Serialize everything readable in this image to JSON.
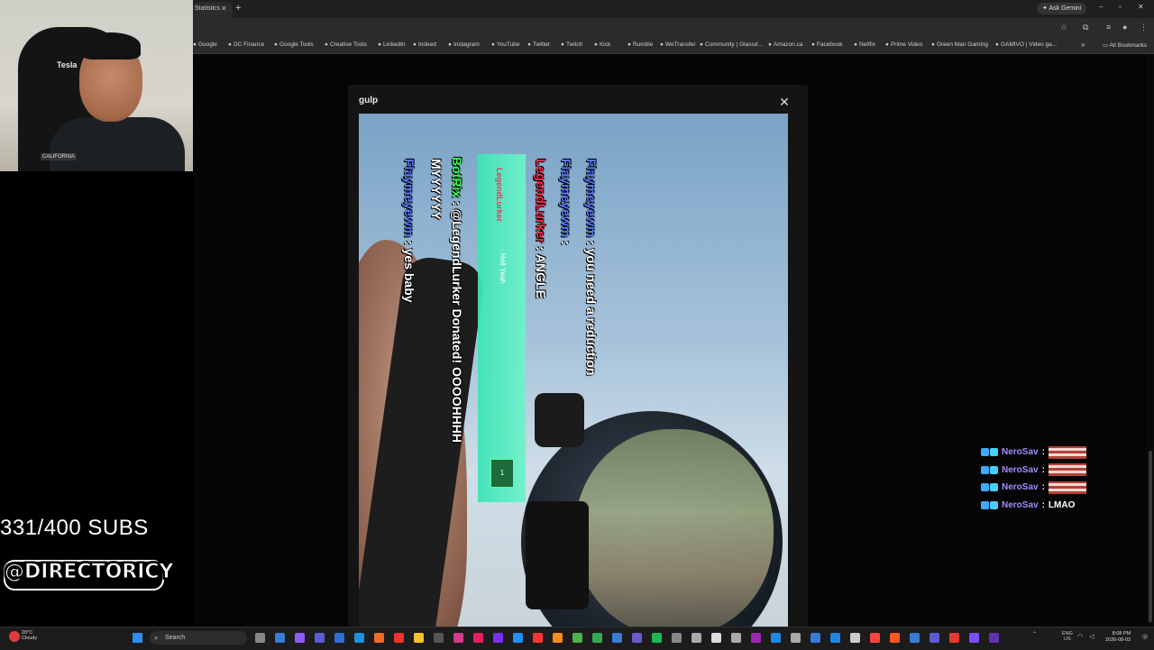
{
  "browser": {
    "tab_title": "Statistics",
    "tab_close": "✕",
    "new_tab": "+",
    "ask_gemini": "Ask Gemini",
    "bookmarks": [
      "Google",
      "DC Finance",
      "Google Tools",
      "Creative Tools",
      "LinkedIn",
      "Indeed",
      "Instagram",
      "YouTube",
      "Twitter",
      "Twitch",
      "Kick",
      "Rumble",
      "WeTransfer",
      "Community | Glassd...",
      "Amazon.ca",
      "Facebook",
      "Netflix",
      "Prime Video",
      "Green Man Gaming",
      "GAMIVO | Video ga..."
    ],
    "all_bookmarks": "All Bookmarks"
  },
  "modal": {
    "title": "gulp",
    "close": "✕"
  },
  "video_chat": [
    {
      "user": "Flaymeyewm",
      "sep": " : ",
      "msg": "you need a reduction",
      "color": "blue"
    },
    {
      "user": "Flaymeyewm",
      "sep": " : ",
      "msg": "",
      "color": "blue"
    },
    {
      "user": "LegendLurker",
      "sep": " : ",
      "msg": "ANGLE",
      "color": "red"
    },
    {
      "user": "BotRix",
      "sep": " : ",
      "msg": "@LegendLurker Donated! OOOOHHHH",
      "color": "green"
    },
    {
      "user": "",
      "sep": "",
      "msg": "MYYYYYY",
      "color": "white"
    },
    {
      "user": "Flaymeyewm",
      "sep": " : ",
      "msg": "yes baby",
      "color": "blue"
    }
  ],
  "alert": {
    "name": "LegendLurker",
    "sub": "- Hell Yeah",
    "button": "1"
  },
  "overlay": {
    "subs": "331/400 SUBS",
    "handle": "@DIRECTORICY",
    "webcam_chair_label": "Tesla",
    "webcam_shirt_label": "CALIFORNIA"
  },
  "side_chat": [
    {
      "user": "NeroSav",
      "text": "",
      "emote": true
    },
    {
      "user": "NeroSav",
      "text": "",
      "emote": true
    },
    {
      "user": "NeroSav",
      "text": "",
      "emote": true
    },
    {
      "user": "NeroSav",
      "text": "LMAO",
      "emote": false
    }
  ],
  "taskbar": {
    "weather_temp": "20°C",
    "weather_desc": "Cloudy",
    "search": "Search",
    "lang1": "ENG",
    "lang2": "US",
    "time": "8:08 PM",
    "date": "2026-08-02"
  }
}
